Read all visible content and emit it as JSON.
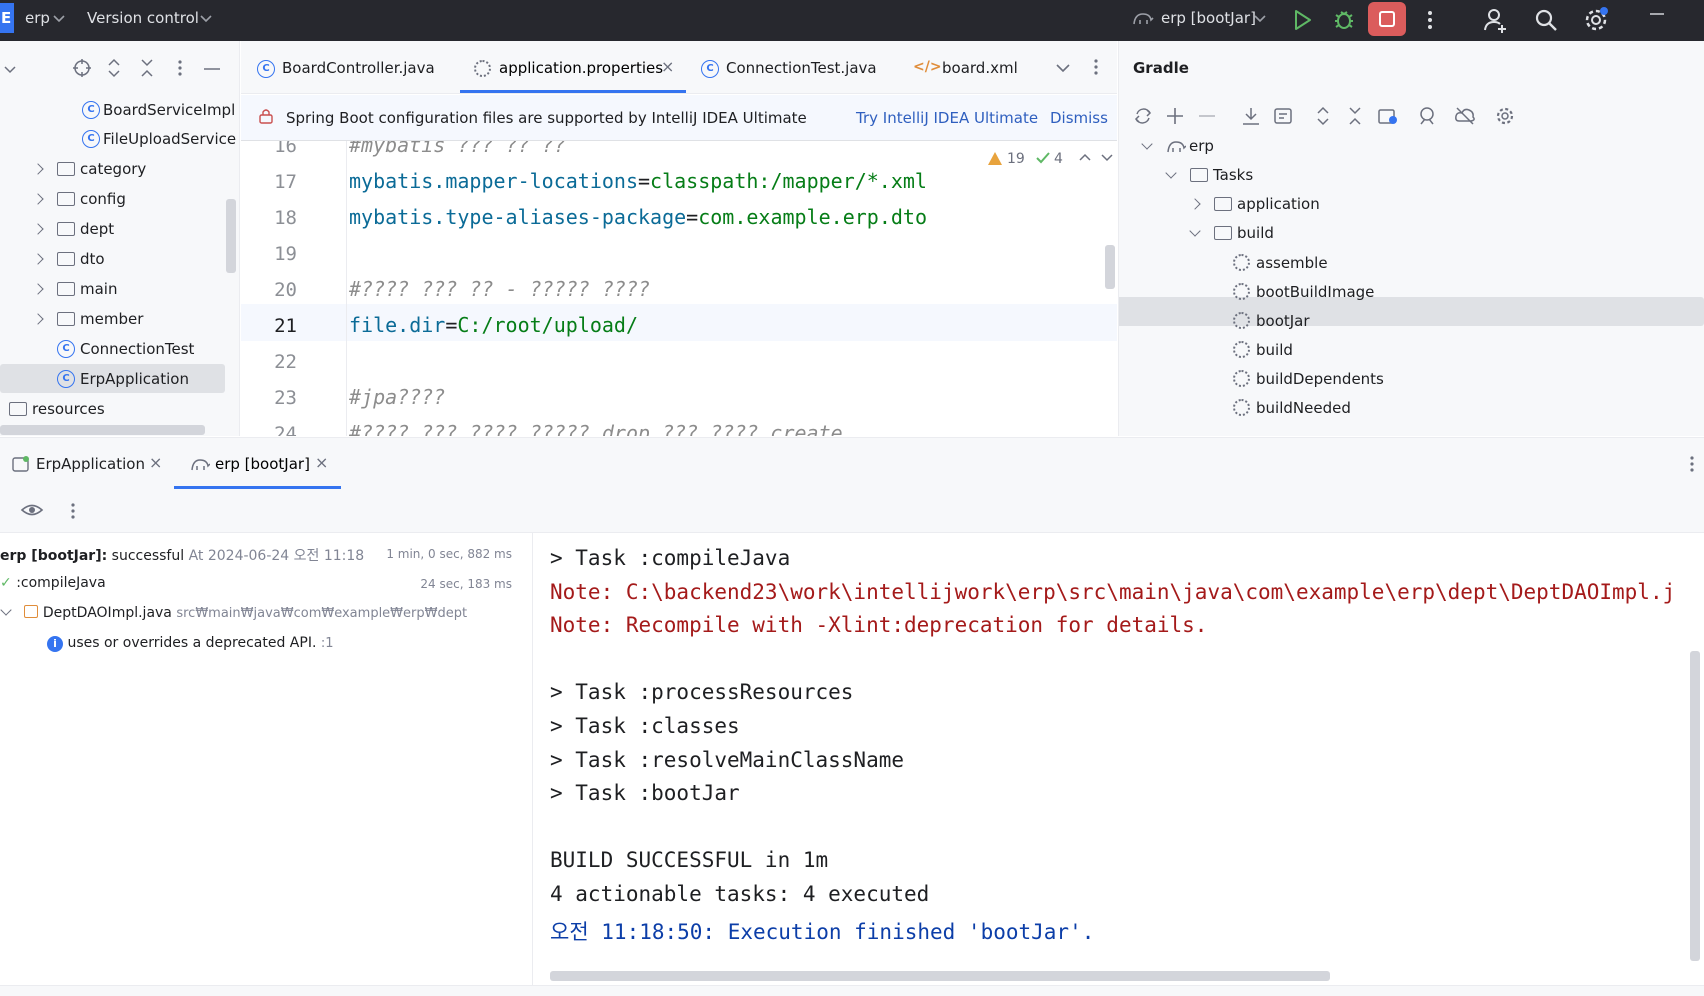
{
  "titlebar": {
    "project_badge": "E",
    "project_name": "erp",
    "vcs_label": "Version control",
    "run_config": "erp [bootJar]"
  },
  "project_tree": {
    "items": [
      {
        "label": "BoardServiceImpl",
        "kind": "class"
      },
      {
        "label": "FileUploadService",
        "kind": "class"
      },
      {
        "label": "category",
        "kind": "folder"
      },
      {
        "label": "config",
        "kind": "folder"
      },
      {
        "label": "dept",
        "kind": "folder"
      },
      {
        "label": "dto",
        "kind": "folder"
      },
      {
        "label": "main",
        "kind": "folder"
      },
      {
        "label": "member",
        "kind": "folder"
      },
      {
        "label": "ConnectionTest",
        "kind": "test-class"
      },
      {
        "label": "ErpApplication",
        "kind": "app-class"
      },
      {
        "label": "resources",
        "kind": "folder"
      }
    ]
  },
  "editor": {
    "tabs": [
      {
        "label": "BoardController.java"
      },
      {
        "label": "application.properties"
      },
      {
        "label": "ConnectionTest.java"
      },
      {
        "label": "board.xml"
      }
    ],
    "banner": {
      "message": "Spring Boot configuration files are supported by IntelliJ IDEA Ultimate",
      "try_link": "Try IntelliJ IDEA Ultimate",
      "dismiss_link": "Dismiss"
    },
    "warnings_count": "19",
    "ok_count": "4",
    "lines": [
      {
        "num": "16",
        "key": "",
        "eq": "",
        "val": "",
        "comment": "#mybatis ??? ?? ??"
      },
      {
        "num": "17",
        "key": "mybatis.mapper-locations",
        "eq": "=",
        "val": "classpath:/mapper/*.xml",
        "comment": ""
      },
      {
        "num": "18",
        "key": "mybatis.type-aliases-package",
        "eq": "=",
        "val": "com.example.erp.dto",
        "comment": ""
      },
      {
        "num": "19",
        "key": "",
        "eq": "",
        "val": "",
        "comment": ""
      },
      {
        "num": "20",
        "key": "",
        "eq": "",
        "val": "",
        "comment": "#???? ??? ?? - ????? ????"
      },
      {
        "num": "21",
        "key": "file.dir",
        "eq": "=",
        "val": "C:/root/upload/",
        "comment": ""
      },
      {
        "num": "22",
        "key": "",
        "eq": "",
        "val": "",
        "comment": ""
      },
      {
        "num": "23",
        "key": "",
        "eq": "",
        "val": "",
        "comment": "#jpa????"
      },
      {
        "num": "24",
        "key": "",
        "eq": "",
        "val": "",
        "comment": "#???? ??? ???? ?????  drop ??? ???? create"
      }
    ]
  },
  "gradle": {
    "title": "Gradle",
    "tree": [
      {
        "label": "erp"
      },
      {
        "label": "Tasks"
      },
      {
        "label": "application"
      },
      {
        "label": "build"
      },
      {
        "label": "assemble"
      },
      {
        "label": "bootBuildImage"
      },
      {
        "label": "bootJar"
      },
      {
        "label": "build"
      },
      {
        "label": "buildDependents"
      },
      {
        "label": "buildNeeded"
      }
    ]
  },
  "run": {
    "tabs": [
      {
        "label": "ErpApplication"
      },
      {
        "label": "erp [bootJar]"
      }
    ],
    "tree": {
      "root_label": "erp [bootJar]:",
      "root_status": "successful",
      "root_time": "At 2024-06-24 오전 11:18",
      "root_duration": "1 min, 0 sec, 882 ms",
      "compile_label": ":compileJava",
      "compile_duration": "24 sec, 183 ms",
      "file_label": "DeptDAOImpl.java",
      "file_path": "src₩main₩java₩com₩example₩erp₩dept",
      "info_label": "uses or overrides a deprecated API.",
      "info_line": ":1"
    },
    "console": [
      {
        "text": "> Task :compileJava",
        "style": "normal"
      },
      {
        "text": "Note: C:\\backend23\\work\\intellijwork\\erp\\src\\main\\java\\com\\example\\erp\\dept\\DeptDAOImpl.j",
        "style": "red"
      },
      {
        "text": "Note: Recompile with -Xlint:deprecation for details.",
        "style": "red"
      },
      {
        "text": "",
        "style": "normal"
      },
      {
        "text": "> Task :processResources",
        "style": "normal"
      },
      {
        "text": "> Task :classes",
        "style": "normal"
      },
      {
        "text": "> Task :resolveMainClassName",
        "style": "normal"
      },
      {
        "text": "> Task :bootJar",
        "style": "normal"
      },
      {
        "text": "",
        "style": "normal"
      },
      {
        "text": "BUILD SUCCESSFUL in 1m",
        "style": "normal"
      },
      {
        "text": "4 actionable tasks: 4 executed",
        "style": "normal"
      },
      {
        "text": "오전 11:18:50: Execution finished 'bootJar'.",
        "style": "blue"
      }
    ]
  },
  "colors": {
    "accent": "#3574f0",
    "stop": "#db5c5c",
    "run_green": "#5fb865",
    "error_red": "#a41a1a",
    "info_blue": "#0c3ea8"
  }
}
